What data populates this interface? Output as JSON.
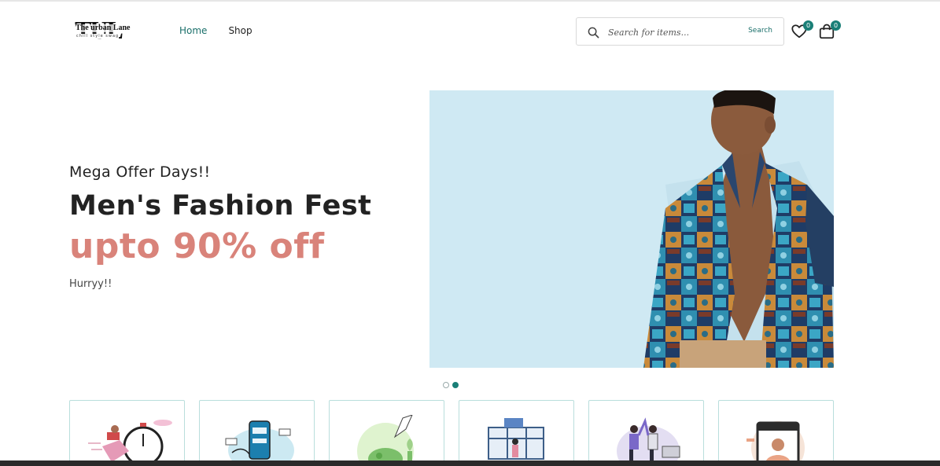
{
  "brand": {
    "monogram": "TUL",
    "name": "The urban Lane",
    "tagline": "chill style swag"
  },
  "nav": {
    "items": [
      {
        "label": "Home",
        "active": true
      },
      {
        "label": "Shop",
        "active": false
      }
    ]
  },
  "search": {
    "placeholder": "Search for items...",
    "button_label": "Search",
    "icon": "search-icon"
  },
  "header_icons": {
    "wishlist": {
      "icon": "heart-icon",
      "count": "0"
    },
    "cart": {
      "icon": "shopping-bag-icon",
      "count": "0"
    }
  },
  "hero": {
    "kicker": "Mega Offer Days!!",
    "headline": "Men's Fashion Fest",
    "offer": "upto 90% off",
    "subtext": "Hurryy!!",
    "image": "man-in-patterned-shirt-photo",
    "slides": 2,
    "active_slide": 2
  },
  "feature_cards": [
    {
      "icon": "fast-delivery-illustration"
    },
    {
      "icon": "mobile-payment-illustration"
    },
    {
      "icon": "savings-piggy-bank-illustration"
    },
    {
      "icon": "online-store-illustration"
    },
    {
      "icon": "customer-support-illustration"
    },
    {
      "icon": "video-consultation-illustration"
    }
  ],
  "colors": {
    "accent": "#1a7f77",
    "offer": "#d9837a",
    "hero_bg": "#cfe9f3"
  }
}
